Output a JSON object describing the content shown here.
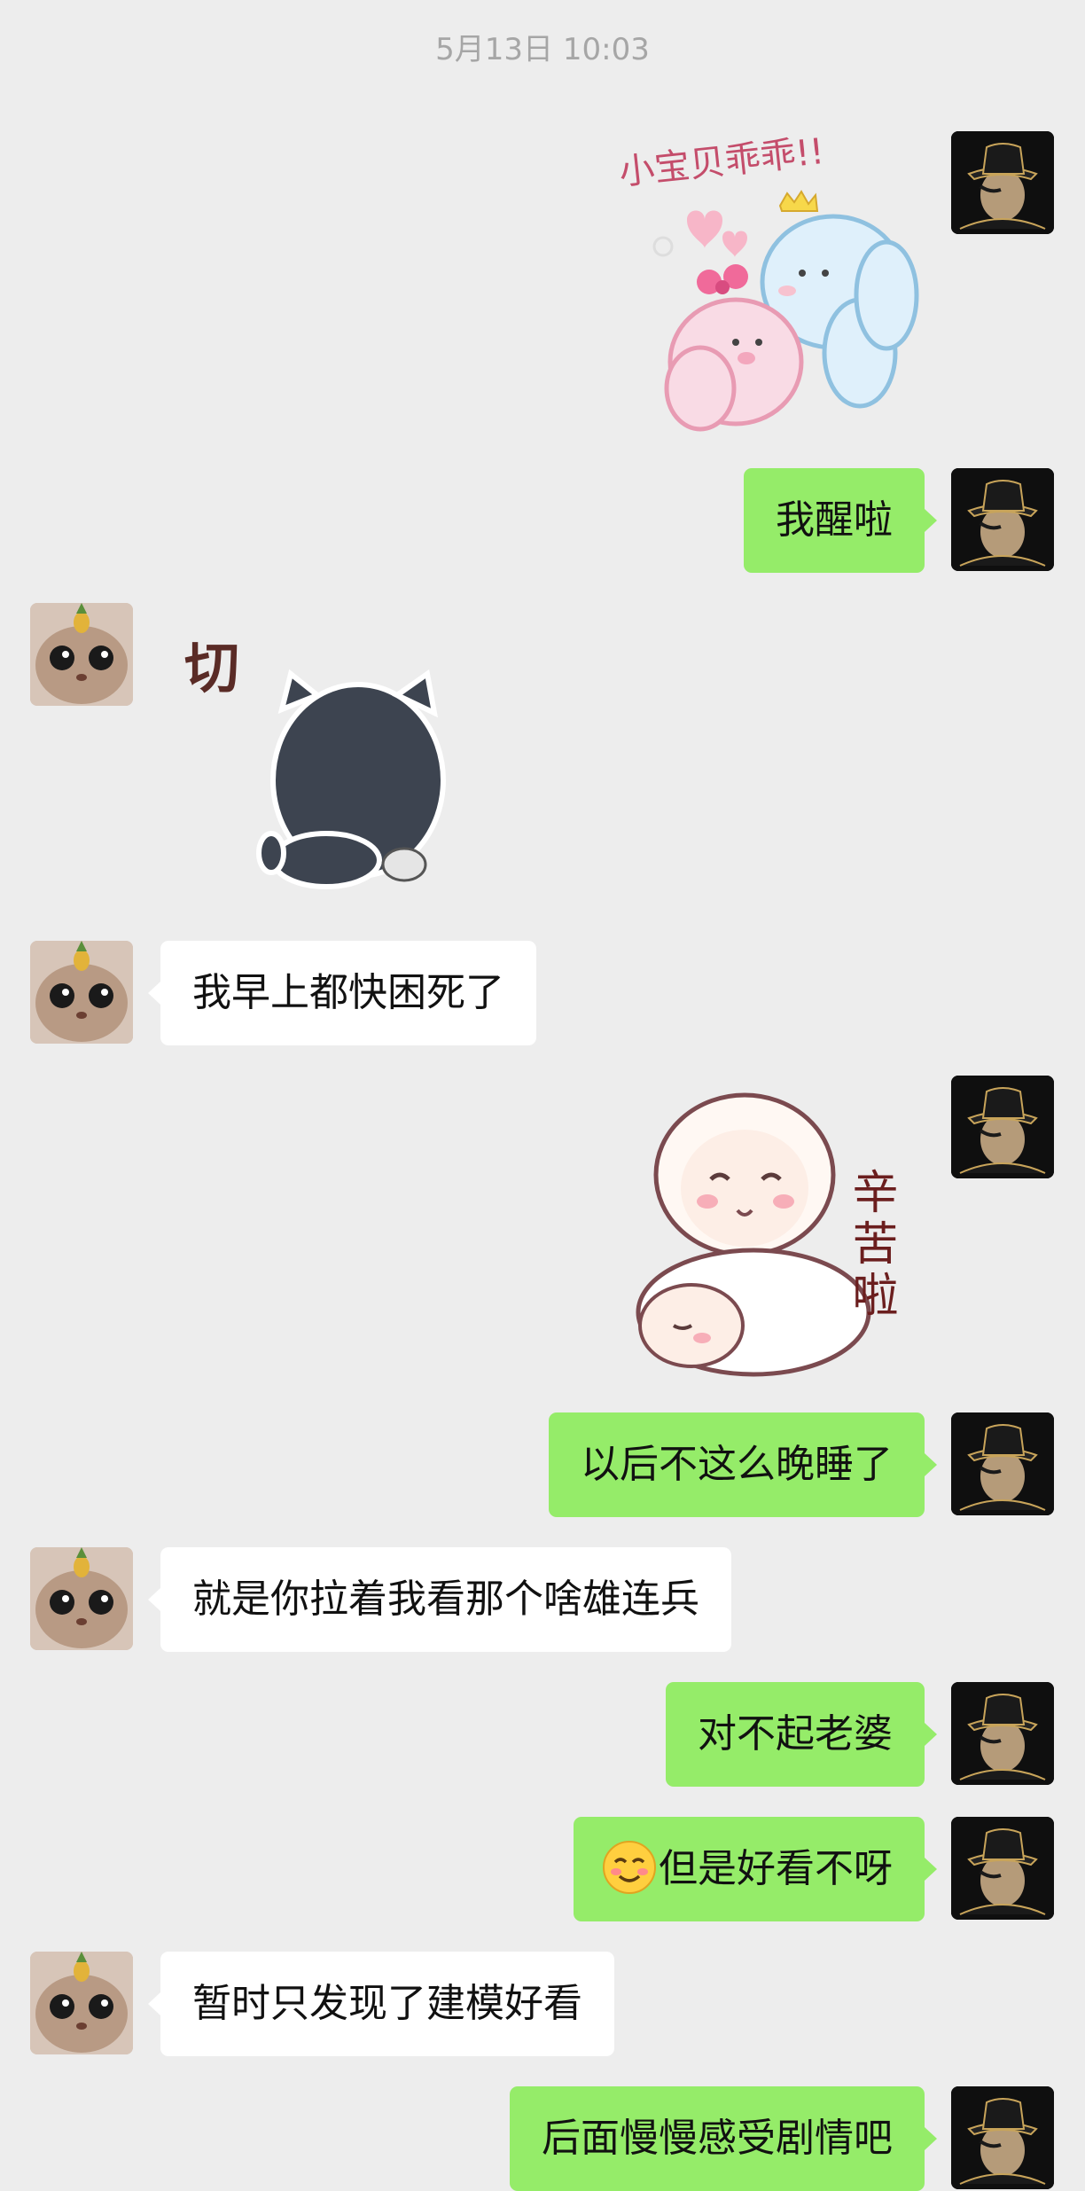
{
  "timestamp": "5月13日 10:03",
  "messages": [
    {
      "id": "m1",
      "sender": "me",
      "type": "sticker",
      "sticker_text": "小宝贝乖乖!!"
    },
    {
      "id": "m2",
      "sender": "me",
      "type": "text",
      "text": "我醒啦"
    },
    {
      "id": "m3",
      "sender": "other",
      "type": "sticker",
      "sticker_text": "切"
    },
    {
      "id": "m4",
      "sender": "other",
      "type": "text",
      "text": "我早上都快困死了"
    },
    {
      "id": "m5",
      "sender": "me",
      "type": "sticker",
      "sticker_text": "辛苦啦"
    },
    {
      "id": "m6",
      "sender": "me",
      "type": "text",
      "text": "以后不这么晚睡了"
    },
    {
      "id": "m7",
      "sender": "other",
      "type": "text",
      "text": "就是你拉着我看那个啥雄连兵"
    },
    {
      "id": "m8",
      "sender": "me",
      "type": "text",
      "text": "对不起老婆"
    },
    {
      "id": "m9",
      "sender": "me",
      "type": "text",
      "text": "但是好看不呀",
      "emoji": "blushing-smile-emoji"
    },
    {
      "id": "m10",
      "sender": "other",
      "type": "text",
      "text": "暂时只发现了建模好看"
    },
    {
      "id": "m11",
      "sender": "me",
      "type": "text",
      "text": "后面慢慢感受剧情吧"
    }
  ],
  "colors": {
    "background": "#ededed",
    "my_bubble": "#95ec69",
    "other_bubble": "#ffffff",
    "timestamp_text": "#a6a6a6"
  },
  "icons": {
    "my_avatar": "hat-figure-avatar",
    "other_avatar": "cat-pineapple-avatar"
  }
}
